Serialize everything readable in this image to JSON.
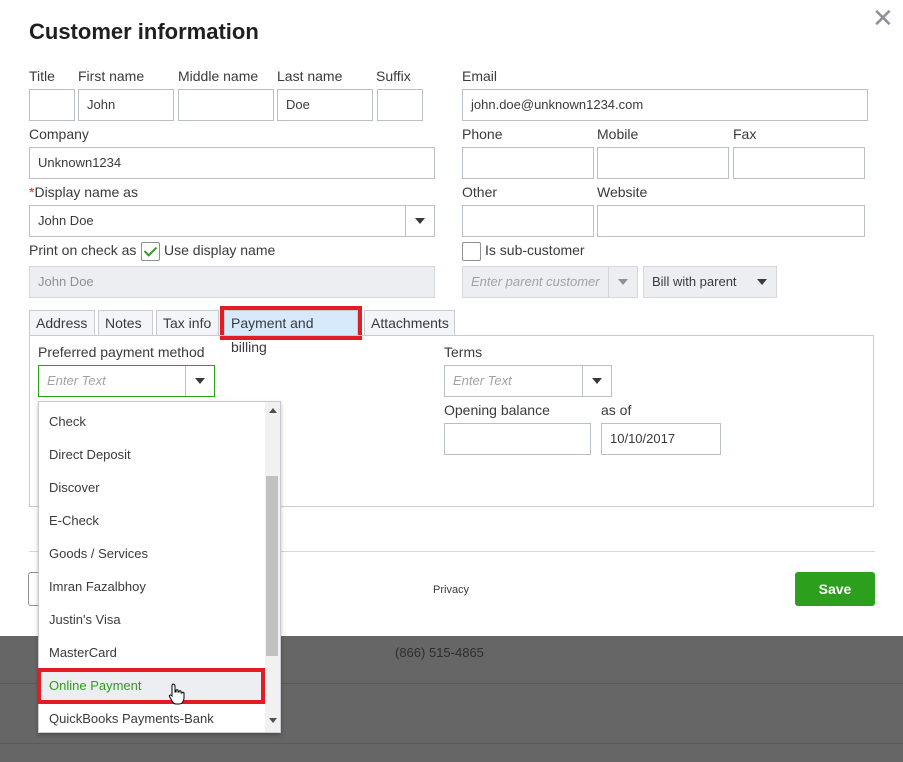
{
  "dialog": {
    "title": "Customer information"
  },
  "name_fields": {
    "title_label": "Title",
    "title_value": "",
    "first_label": "First name",
    "first_value": "John",
    "middle_label": "Middle name",
    "middle_value": "",
    "last_label": "Last name",
    "last_value": "Doe",
    "suffix_label": "Suffix",
    "suffix_value": ""
  },
  "email": {
    "label": "Email",
    "value": "john.doe@unknown1234.com"
  },
  "company": {
    "label": "Company",
    "value": "Unknown1234"
  },
  "phones": {
    "phone_label": "Phone",
    "phone_value": "",
    "mobile_label": "Mobile",
    "mobile_value": "",
    "fax_label": "Fax",
    "fax_value": "",
    "other_label": "Other",
    "other_value": "",
    "website_label": "Website",
    "website_value": ""
  },
  "display_name": {
    "required_mark": "*",
    "label": "Display name as",
    "value": "John  Doe"
  },
  "print_check": {
    "label": "Print on check as",
    "checkbox_label": "Use display name",
    "checked": true,
    "value": "John  Doe"
  },
  "sub_customer": {
    "checkbox_label": "Is sub-customer",
    "checked": false,
    "parent_placeholder": "Enter parent customer",
    "bill_option": "Bill with parent"
  },
  "tabs": [
    {
      "label": "Address",
      "active": false
    },
    {
      "label": "Notes",
      "active": false
    },
    {
      "label": "Tax info",
      "active": false
    },
    {
      "label": "Payment and billing",
      "active": true
    },
    {
      "label": "Attachments",
      "active": false
    }
  ],
  "payment": {
    "method_label": "Preferred payment method",
    "method_placeholder": "Enter Text",
    "terms_label": "Terms",
    "terms_placeholder": "Enter Text",
    "opening_balance_label": "Opening balance",
    "opening_balance_value": "",
    "as_of_label": "as of",
    "as_of_value": "10/10/2017"
  },
  "dropdown": {
    "items": [
      "Check",
      "Direct Deposit",
      "Discover",
      "E-Check",
      "Goods / Services",
      "Imran Fazalbhoy",
      "Justin's Visa",
      "MasterCard",
      "Online Payment",
      "QuickBooks Payments-Bank"
    ],
    "selected": "Online Payment"
  },
  "footer": {
    "privacy": "Privacy",
    "save": "Save"
  },
  "background": {
    "phone": "(866) 515-4865"
  },
  "colors": {
    "accent_green": "#2ca01c",
    "highlight_red": "#e31c24",
    "active_tab": "#d7eafc"
  }
}
